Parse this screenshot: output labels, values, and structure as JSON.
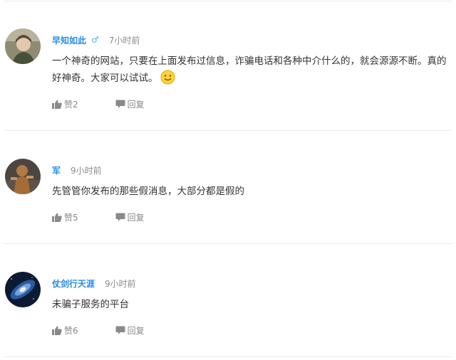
{
  "comments": [
    {
      "username": "早知如此",
      "gender_symbol": "♂",
      "time": "7小时前",
      "text": "一个神奇的网站，只要在上面发布过信息，诈骗电话和各种中介什么的，就会源源不断。真的好神奇。大家可以试试。",
      "emoji": "smile-emoji-icon",
      "likes_label": "赞2",
      "reply_label": "回复"
    },
    {
      "username": "军",
      "time": "9小时前",
      "text": "先管管你发布的那些假消息，大部分都是假的",
      "likes_label": "赞5",
      "reply_label": "回复"
    },
    {
      "username": "仗剑行天涯",
      "time": "9小时前",
      "text": "未骗子服务的平台",
      "likes_label": "赞6",
      "reply_label": "回复"
    }
  ],
  "colors": {
    "username": "#2a8ce0",
    "muted": "#8a8a8a",
    "text": "#333333",
    "divider": "#ececec"
  }
}
